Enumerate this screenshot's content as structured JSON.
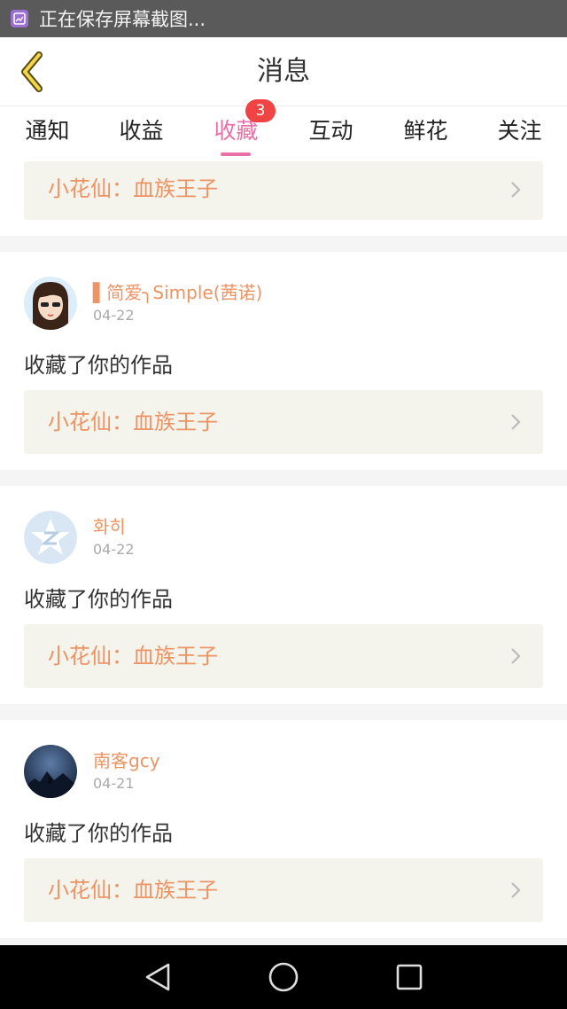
{
  "status_bar": {
    "text": "正在保存屏幕截图...",
    "icon": "screenshot-icon"
  },
  "header": {
    "title": "消息",
    "back_icon": "back-arrow-icon"
  },
  "tabs": [
    {
      "label": "通知"
    },
    {
      "label": "收益"
    },
    {
      "label": "收藏",
      "active": true,
      "badge": "3"
    },
    {
      "label": "互动"
    },
    {
      "label": "鲜花"
    },
    {
      "label": "关注"
    }
  ],
  "messages": [
    {
      "work": "小花仙：血族王子"
    },
    {
      "user": "▌简爱╮Simple(茜诺)",
      "date": "04-22",
      "action": "收藏了你的作品",
      "work": "小花仙：血族王子"
    },
    {
      "user": "화히",
      "date": "04-22",
      "action": "收藏了你的作品",
      "work": "小花仙：血族王子"
    },
    {
      "user": "南客gcy",
      "date": "04-21",
      "action": "收藏了你的作品",
      "work": "小花仙：血族王子"
    }
  ],
  "nav": {
    "back": "nav-back-icon",
    "home": "nav-home-icon",
    "recents": "nav-recents-icon"
  },
  "colors": {
    "accent": "#e96fa6",
    "orange_text": "#ec9464",
    "badge": "#f04343",
    "work_box": "#f4f3ec"
  }
}
